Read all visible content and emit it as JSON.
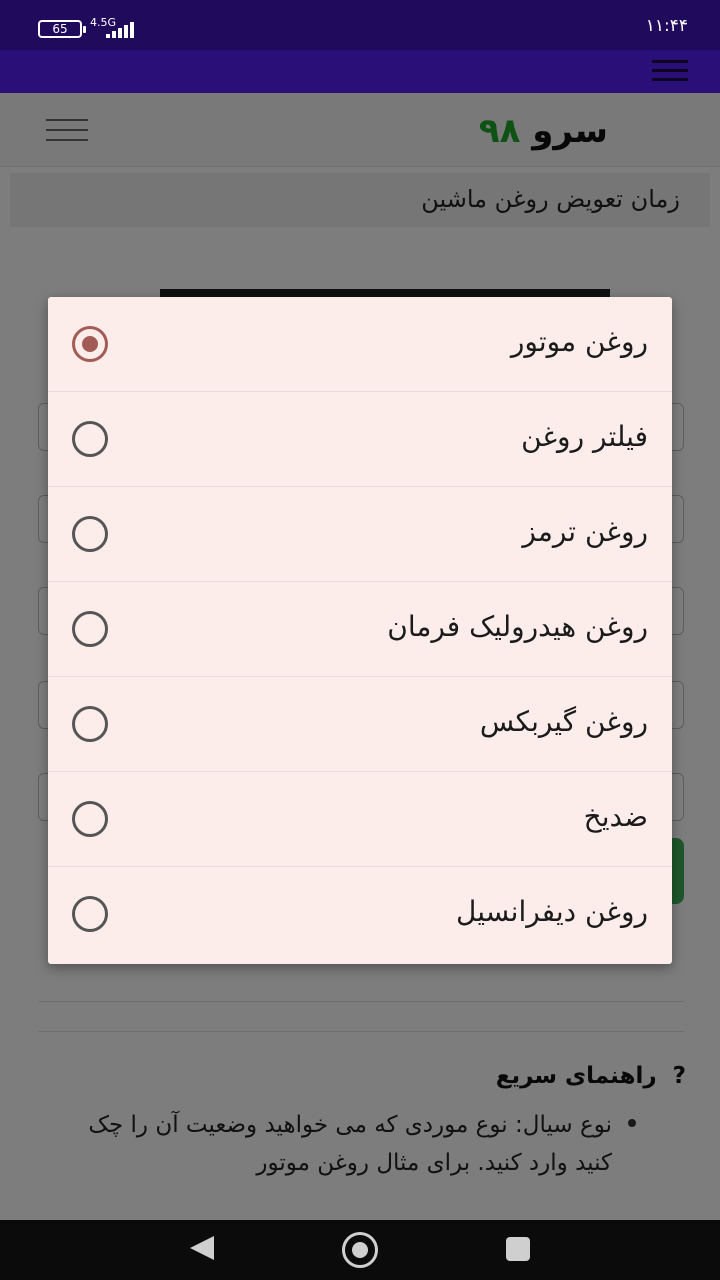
{
  "status_bar": {
    "battery": "65",
    "network": "4.5G",
    "time": "۱۱:۴۴"
  },
  "site": {
    "logo_text": "سرو",
    "logo_number": "۹۸",
    "breadcrumb": "زمان تعویض روغن ماشین"
  },
  "dialog": {
    "selected_index": 0,
    "options": [
      {
        "label": "روغن موتور",
        "checked": true
      },
      {
        "label": "فیلتر روغن",
        "checked": false
      },
      {
        "label": "روغن ترمز",
        "checked": false
      },
      {
        "label": "روغن هیدرولیک فرمان",
        "checked": false
      },
      {
        "label": "روغن گیربکس",
        "checked": false
      },
      {
        "label": "ضدیخ",
        "checked": false
      },
      {
        "label": "روغن دیفرانسیل",
        "checked": false
      }
    ]
  },
  "help": {
    "icon": "?",
    "title": "راهنمای سریع",
    "text": "نوع سیال: نوع موردی که می خواهید وضعیت آن را چک کنید وارد کنید. برای مثال روغن موتور"
  },
  "colors": {
    "status_bar": "#1f0a5c",
    "browser_bar": "#2a0f78",
    "logo_accent": "#1fa52d",
    "radio_checked": "#a35c55",
    "dialog_bg": "#fcedeb"
  }
}
